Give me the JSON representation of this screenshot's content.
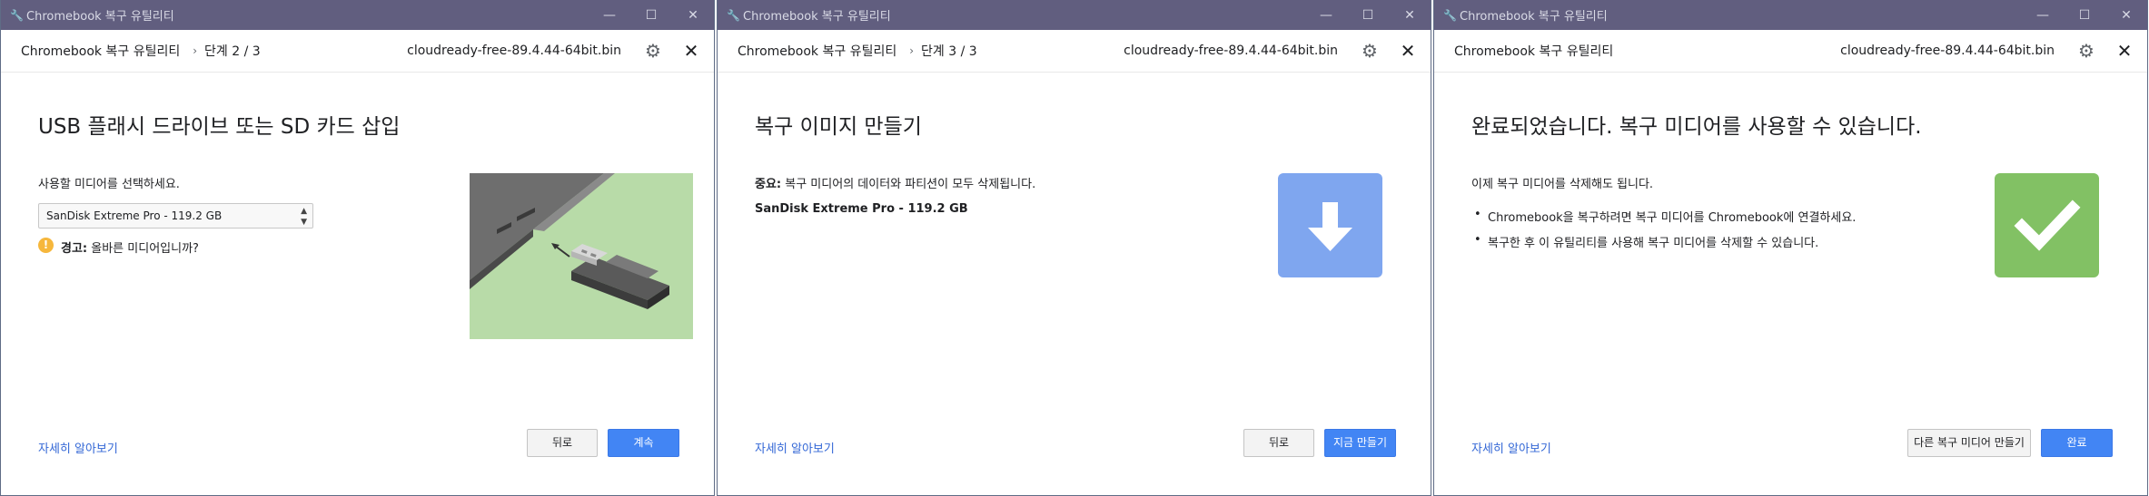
{
  "colors": {
    "titlebar": "#615e7f",
    "accent": "#4285f4",
    "link": "#3367d6",
    "download_tile": "#7fa6ef",
    "success_tile": "#82c164",
    "warning": "#f6b73c",
    "illustration_bg": "#b8dba8"
  },
  "windows": [
    {
      "title": "Chromebook 복구 유틸리티",
      "header": {
        "app_name": "Chromebook 복구 유틸리티",
        "step": "단계 2 / 3",
        "file": "cloudready-free-89.4.44-64bit.bin"
      },
      "heading": "USB 플래시 드라이브 또는 SD 카드 삽입",
      "prompt": "사용할 미디어를 선택하세요.",
      "select_value": "SanDisk Extreme Pro - 119.2 GB",
      "warning_label": "경고:",
      "warning_text": " 올바른 미디어입니까?",
      "illustration": "usb-insert-illustration",
      "learn_more": "자세히 알아보기",
      "back_button": "뒤로",
      "primary_button": "계속"
    },
    {
      "title": "Chromebook 복구 유틸리티",
      "header": {
        "app_name": "Chromebook 복구 유틸리티",
        "step": "단계 3 / 3",
        "file": "cloudready-free-89.4.44-64bit.bin"
      },
      "heading": "복구 이미지 만들기",
      "important_label": "중요:",
      "important_text": " 복구 미디어의 데이터와 파티션이 모두 삭제됩니다.",
      "device": "SanDisk Extreme Pro - 119.2 GB",
      "icon": "download-arrow-icon",
      "learn_more": "자세히 알아보기",
      "back_button": "뒤로",
      "primary_button": "지금 만들기"
    },
    {
      "title": "Chromebook 복구 유틸리티",
      "header": {
        "app_name": "Chromebook 복구 유틸리티",
        "file": "cloudready-free-89.4.44-64bit.bin"
      },
      "heading": "완료되었습니다. 복구 미디어를 사용할 수 있습니다.",
      "info": "이제 복구 미디어를 삭제해도 됩니다.",
      "bullets": [
        "Chromebook을 복구하려면 복구 미디어를 Chromebook에 연결하세요.",
        "복구한 후 이 유틸리티를 사용해 복구 미디어를 삭제할 수 있습니다."
      ],
      "icon": "checkmark-icon",
      "learn_more": "자세히 알아보기",
      "secondary_button": "다른 복구 미디어 만들기",
      "primary_button": "완료"
    }
  ]
}
